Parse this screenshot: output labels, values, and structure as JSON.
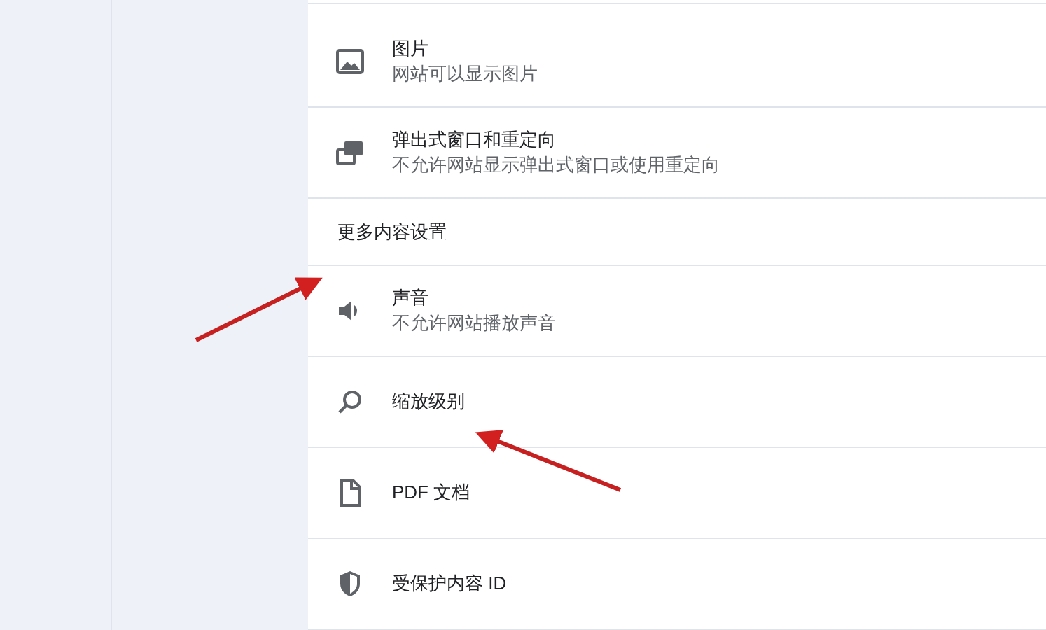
{
  "rows": [
    {
      "kind": "setting",
      "title": "图片",
      "subtitle": "网站可以显示图片"
    },
    {
      "kind": "setting",
      "title": "弹出式窗口和重定向",
      "subtitle": "不允许网站显示弹出式窗口或使用重定向"
    },
    {
      "kind": "heading",
      "title": "更多内容设置"
    },
    {
      "kind": "setting",
      "title": "声音",
      "subtitle": "不允许网站播放声音"
    },
    {
      "kind": "setting",
      "title": "缩放级别"
    },
    {
      "kind": "setting",
      "title": "PDF 文档"
    },
    {
      "kind": "setting",
      "title": "受保护内容 ID"
    }
  ]
}
